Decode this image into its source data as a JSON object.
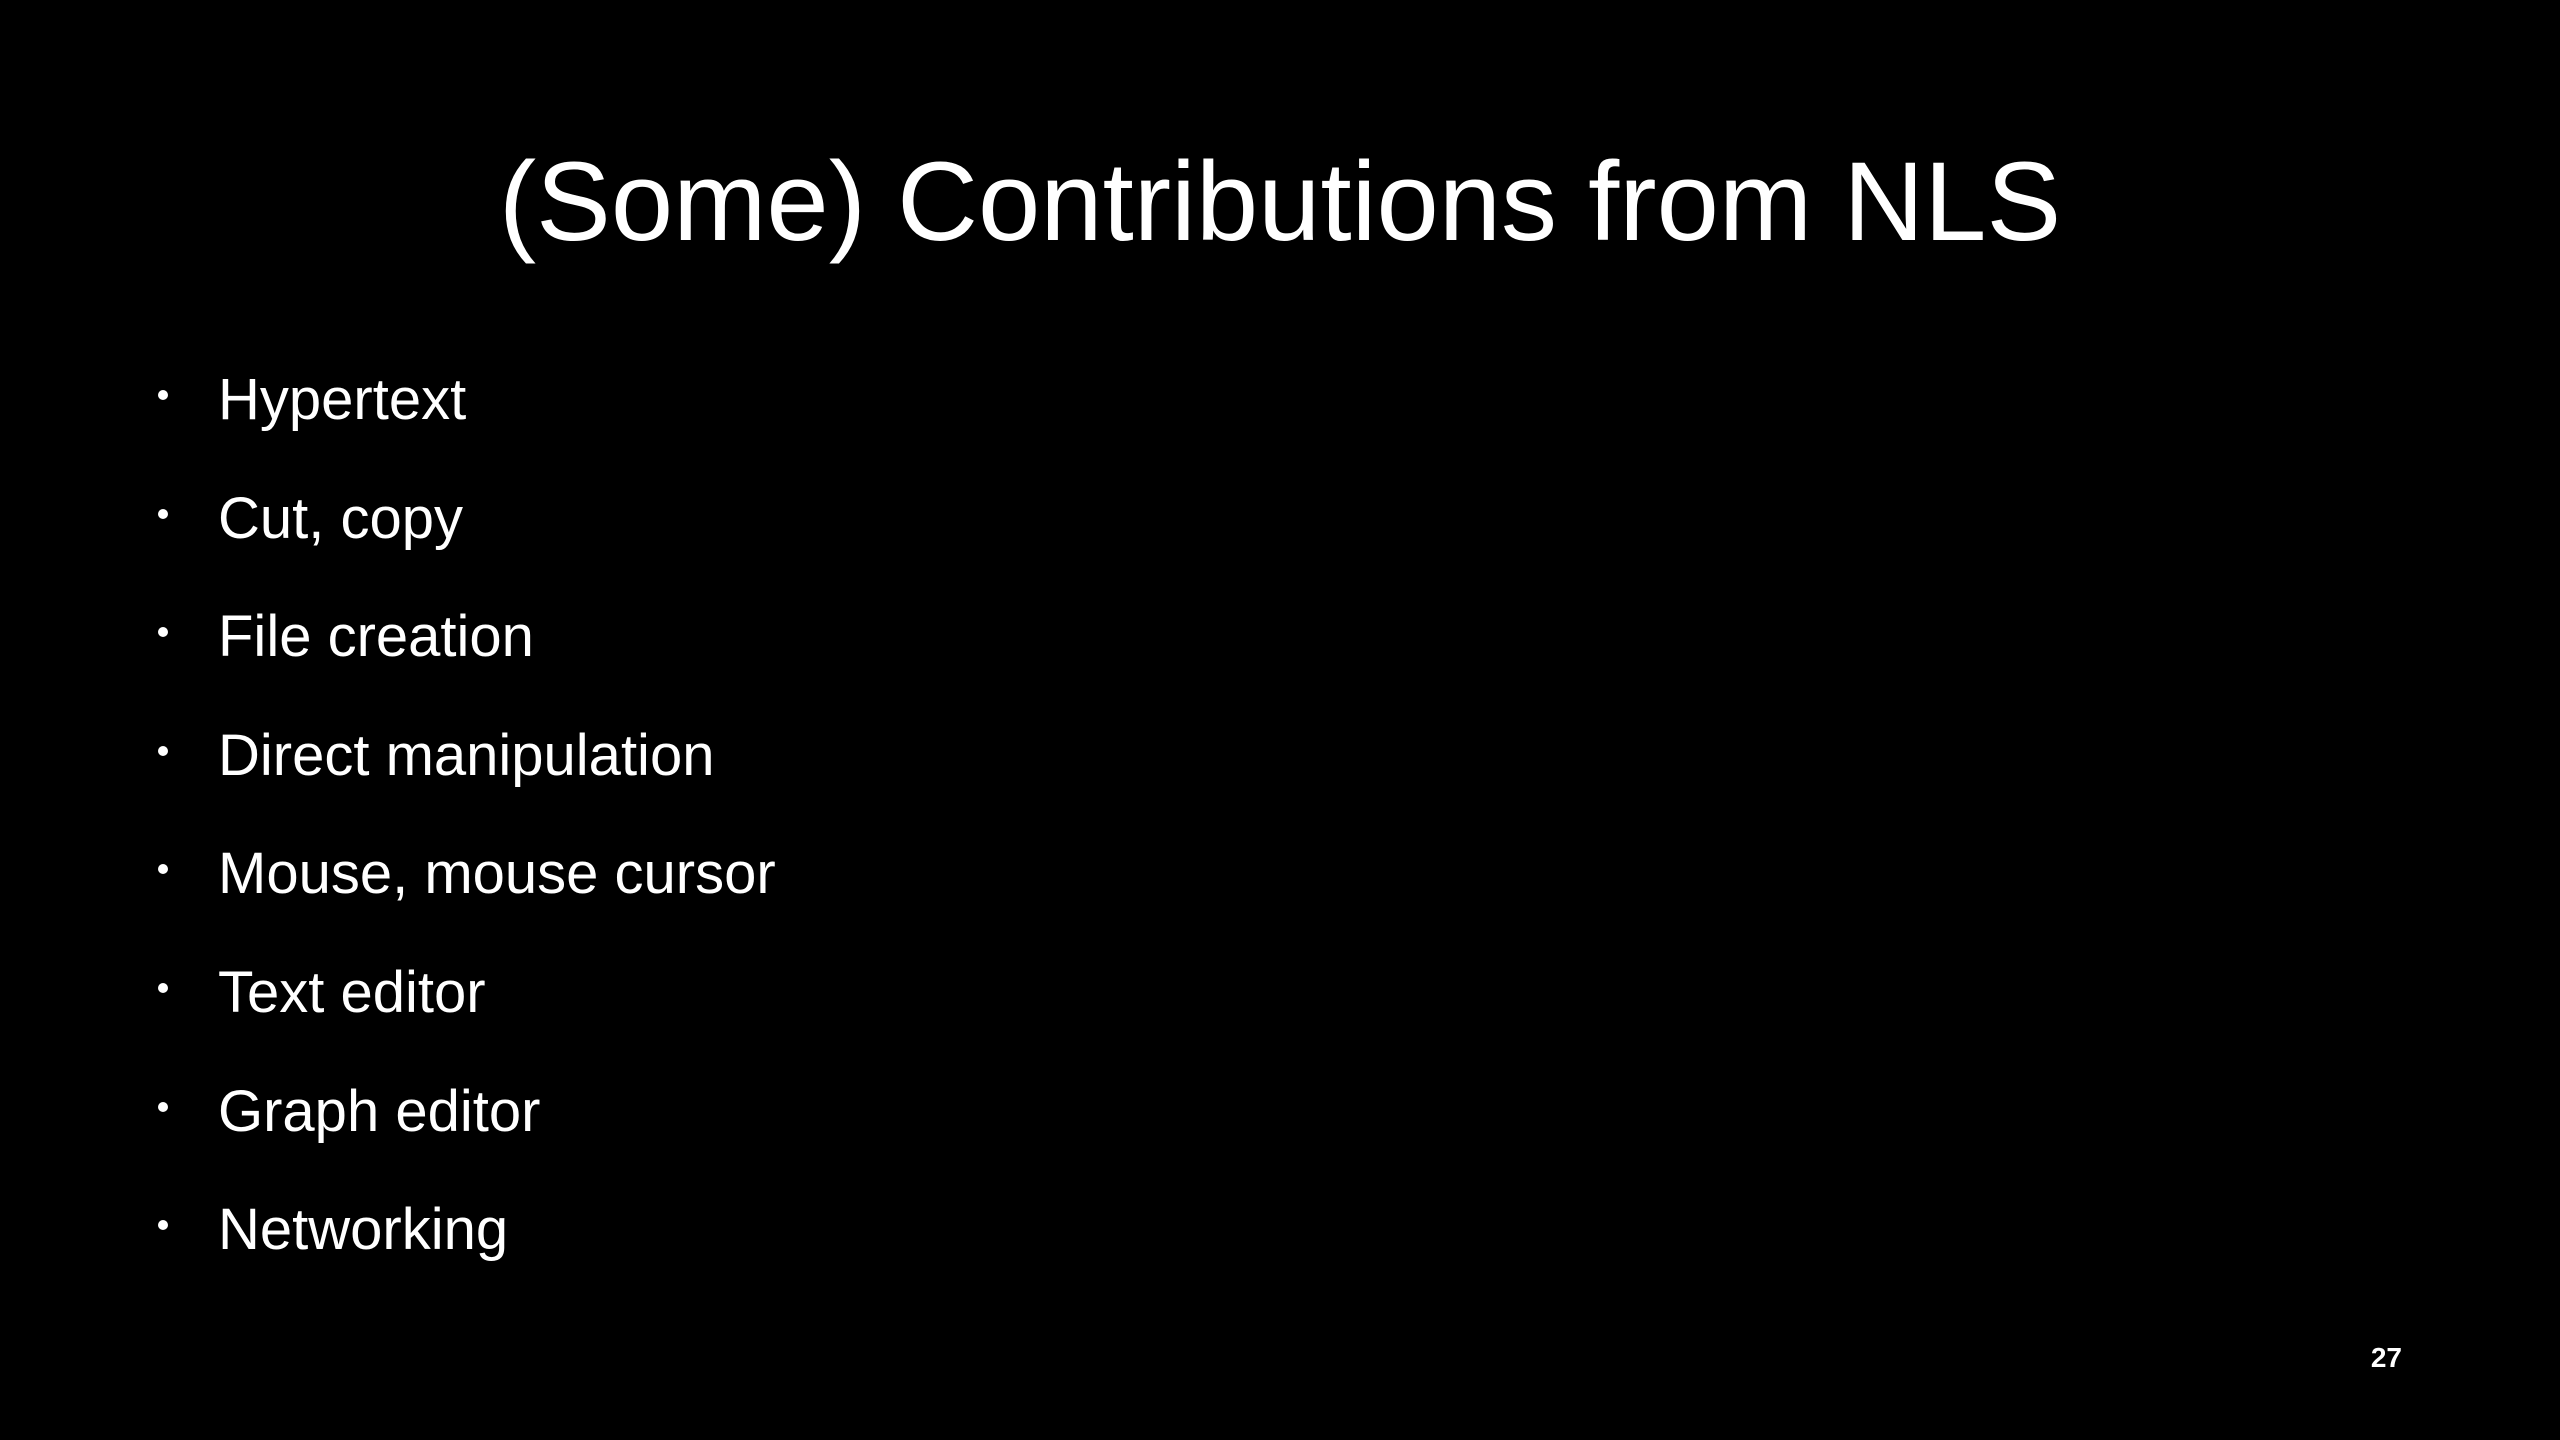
{
  "slide": {
    "title": "(Some) Contributions from NLS",
    "bullets": [
      "Hypertext",
      "Cut, copy",
      "File creation",
      "Direct manipulation",
      "Mouse, mouse cursor",
      "Text editor",
      "Graph editor",
      "Networking"
    ],
    "page_number": "27"
  },
  "colors": {
    "background": "#000000",
    "text": "#ffffff"
  }
}
